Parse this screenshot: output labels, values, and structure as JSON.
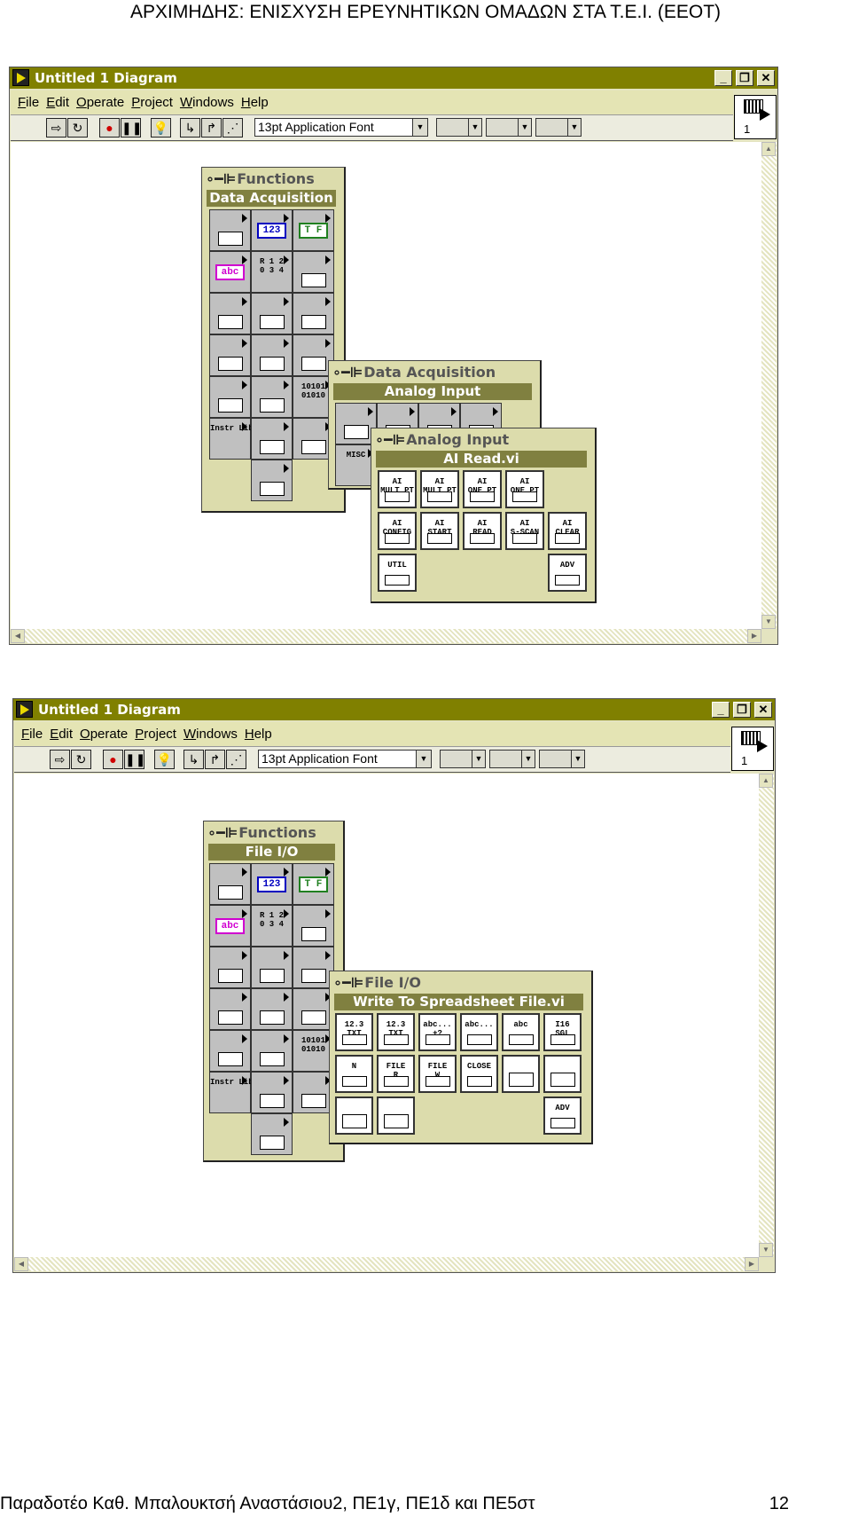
{
  "header": "ΑΡΧΙΜΗΔΗΣ: ΕΝΙΣΧΥΣΗ ΕΡΕΥΝΗΤΙΚΩΝ ΟΜΑΔΩΝ ΣΤΑ Τ.Ε.Ι. (ΕΕΟΤ)",
  "footer": "Παραδοτέο Καθ. Μπαλουκτσή Αναστάσιου2, ΠΕ1γ, ΠΕ1δ και ΠΕ5στ",
  "page_number": "12",
  "colors": {
    "titlebar": "#808000",
    "palette": "#dcdcac",
    "palette_header": "#808040"
  },
  "windows": [
    {
      "title": "Untitled 1 Diagram",
      "menu": [
        "File",
        "Edit",
        "Operate",
        "Project",
        "Windows",
        "Help"
      ],
      "font_select": "13pt Application Font",
      "connector_number": "1",
      "palettes": [
        {
          "title": "Functions",
          "subtitle": "Data Acquisition",
          "cells": [
            {
              "icon": "structures-icon",
              "text": ""
            },
            {
              "icon": "numeric-icon",
              "text": "123",
              "color": "#0000c0"
            },
            {
              "icon": "boolean-icon",
              "text": "T F",
              "color": "#208020"
            },
            {
              "icon": "string-icon",
              "text": "abc",
              "color": "#d000d0"
            },
            {
              "icon": "array-cluster-icon",
              "text": "R 1 2\n0 3 4"
            },
            {
              "icon": "cluster-icon",
              "text": ""
            },
            {
              "icon": "comparison-icon",
              "text": ""
            },
            {
              "icon": "time-dialog-icon",
              "text": ""
            },
            {
              "icon": "file-io-icon",
              "text": ""
            },
            {
              "icon": "communication-icon",
              "text": ""
            },
            {
              "icon": "instrument-io-icon",
              "text": ""
            },
            {
              "icon": "data-acquisition-icon",
              "text": ""
            },
            {
              "icon": "analysis-icon",
              "text": ""
            },
            {
              "icon": "tutorial-icon",
              "text": ""
            },
            {
              "icon": "advanced-icon",
              "text": "10101\n01010"
            },
            {
              "icon": "instrument-library-icon",
              "text": "Instr Lib"
            },
            {
              "icon": "user-libraries-icon",
              "text": ""
            },
            {
              "icon": "select-vi-icon",
              "text": ""
            },
            {
              "icon": "select-vi-bottom-icon",
              "text": ""
            }
          ]
        },
        {
          "title": "Data Acquisition",
          "subtitle": "Analog Input",
          "cells": [
            {
              "icon": "analog-input-icon",
              "text": ""
            },
            {
              "icon": "analog-output-icon",
              "text": ""
            },
            {
              "icon": "digital-io-icon",
              "text": ""
            },
            {
              "icon": "counter-icon",
              "text": ""
            },
            {
              "icon": "misc-icon",
              "text": "MISC"
            }
          ]
        },
        {
          "title": "Analog Input",
          "subtitle": "AI Read.vi",
          "cells": [
            {
              "icon": "ai-mult-pt-icon",
              "text": "AI\nMULT PT"
            },
            {
              "icon": "ai-mult-pt-icon",
              "text": "AI\nMULT PT"
            },
            {
              "icon": "ai-one-pt-icon",
              "text": "AI\nONE PT"
            },
            {
              "icon": "ai-one-pt-icon",
              "text": "AI\nONE PT"
            },
            {
              "icon": "ai-config-icon",
              "text": "AI\nCONFIG"
            },
            {
              "icon": "ai-start-icon",
              "text": "AI\nSTART"
            },
            {
              "icon": "ai-read-icon",
              "text": "AI\nREAD"
            },
            {
              "icon": "ai-s-scan-icon",
              "text": "AI\nS-SCAN"
            },
            {
              "icon": "ai-clear-icon",
              "text": "AI\nCLEAR"
            },
            {
              "icon": "ai-util-icon",
              "text": "UTIL"
            },
            {
              "icon": "ai-adv-icon",
              "text": "ADV"
            }
          ]
        }
      ]
    },
    {
      "title": "Untitled 1 Diagram",
      "menu": [
        "File",
        "Edit",
        "Operate",
        "Project",
        "Windows",
        "Help"
      ],
      "font_select": "13pt Application Font",
      "connector_number": "1",
      "palettes": [
        {
          "title": "Functions",
          "subtitle": "File I/O",
          "cells": [
            {
              "icon": "structures-icon",
              "text": ""
            },
            {
              "icon": "numeric-icon",
              "text": "123",
              "color": "#0000c0"
            },
            {
              "icon": "boolean-icon",
              "text": "T F",
              "color": "#208020"
            },
            {
              "icon": "string-icon",
              "text": "abc",
              "color": "#d000d0"
            },
            {
              "icon": "array-cluster-icon",
              "text": "R 1 2\n0 3 4"
            },
            {
              "icon": "cluster-icon",
              "text": ""
            },
            {
              "icon": "comparison-icon",
              "text": ""
            },
            {
              "icon": "time-dialog-icon",
              "text": ""
            },
            {
              "icon": "file-io-icon",
              "text": ""
            },
            {
              "icon": "communication-icon",
              "text": ""
            },
            {
              "icon": "instrument-io-icon",
              "text": ""
            },
            {
              "icon": "data-acquisition-icon",
              "text": ""
            },
            {
              "icon": "analysis-icon",
              "text": ""
            },
            {
              "icon": "tutorial-icon",
              "text": ""
            },
            {
              "icon": "advanced-icon",
              "text": "10101\n01010"
            },
            {
              "icon": "instrument-library-icon",
              "text": "Instr Lib"
            },
            {
              "icon": "user-libraries-icon",
              "text": ""
            },
            {
              "icon": "select-vi-icon",
              "text": ""
            },
            {
              "icon": "select-vi-bottom-icon",
              "text": ""
            }
          ]
        },
        {
          "title": "File I/O",
          "subtitle": "Write To Spreadsheet File.vi",
          "cells": [
            {
              "icon": "write-spreadsheet-icon",
              "text": "12.3\nTXT"
            },
            {
              "icon": "read-spreadsheet-icon",
              "text": "12.3\nTXT"
            },
            {
              "icon": "write-characters-icon",
              "text": "abc...\n+?"
            },
            {
              "icon": "read-characters-icon",
              "text": "abc..."
            },
            {
              "icon": "read-lines-icon",
              "text": "abc"
            },
            {
              "icon": "binary-file-icon",
              "text": "I16\nSGL"
            },
            {
              "icon": "open-create-replace-icon",
              "text": "N"
            },
            {
              "icon": "read-file-icon",
              "text": "FILE\nR"
            },
            {
              "icon": "write-file-icon",
              "text": "FILE\nW"
            },
            {
              "icon": "close-file-icon",
              "text": "CLOSE"
            },
            {
              "icon": "build-path-icon",
              "text": ""
            },
            {
              "icon": "strip-path-icon",
              "text": ""
            },
            {
              "icon": "file-constants-icon",
              "text": ""
            },
            {
              "icon": "config-file-icon",
              "text": ""
            },
            {
              "icon": "file-advanced-icon",
              "text": "ADV"
            }
          ]
        }
      ]
    }
  ]
}
